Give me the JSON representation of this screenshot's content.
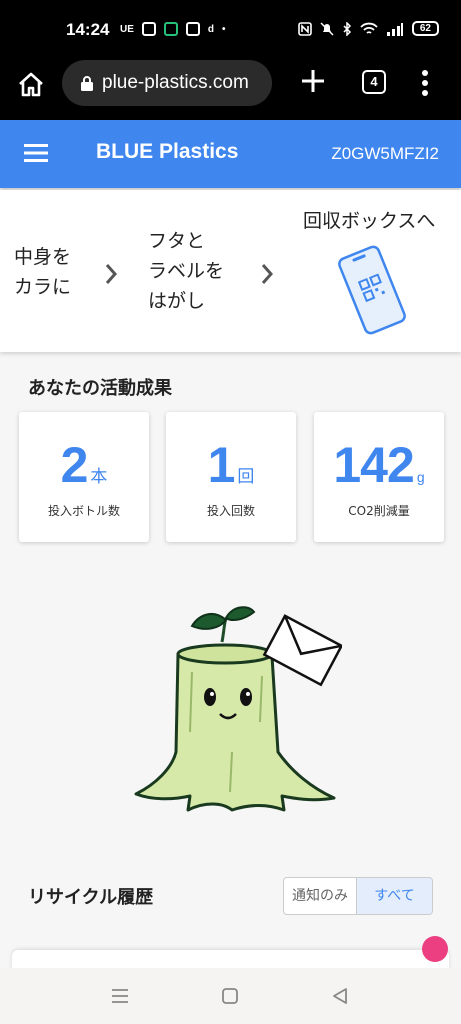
{
  "status_bar": {
    "time": "14:24",
    "left_text": "UE",
    "battery": "62"
  },
  "browser": {
    "url": "plue-plastics.com",
    "tab_count": "4"
  },
  "app": {
    "title": "BLUE Plastics",
    "code": "Z0GW5MFZI2"
  },
  "steps": [
    {
      "text": "中身を\nカラに"
    },
    {
      "text": "フタと\nラベルを\nはがし"
    },
    {
      "text": "回収ボックスへ"
    }
  ],
  "activity": {
    "title": "あなたの活動成果",
    "cards": [
      {
        "value": "2",
        "unit": "本",
        "label": "投入ボトル数"
      },
      {
        "value": "1",
        "unit": "回",
        "label": "投入回数"
      },
      {
        "value": "142",
        "unit": "g",
        "label": "CO2削減量"
      }
    ]
  },
  "history": {
    "title": "リサイクル履歴",
    "toggle": {
      "option1": "通知のみ",
      "option2": "すべて"
    }
  },
  "icons": {
    "home": "home-icon",
    "lock": "lock-icon",
    "plus": "plus-icon",
    "menu": "more-vert-icon",
    "hamburger": "hamburger-icon",
    "chevron": "chevron-right-icon",
    "phone_qr": "phone-qr-icon",
    "nav_recent": "recents-icon",
    "nav_home": "home-square-icon",
    "nav_back": "back-icon"
  },
  "colors": {
    "primary": "#3f86ef",
    "accent_dot": "#ec3f82",
    "background": "#f6f6f6"
  }
}
